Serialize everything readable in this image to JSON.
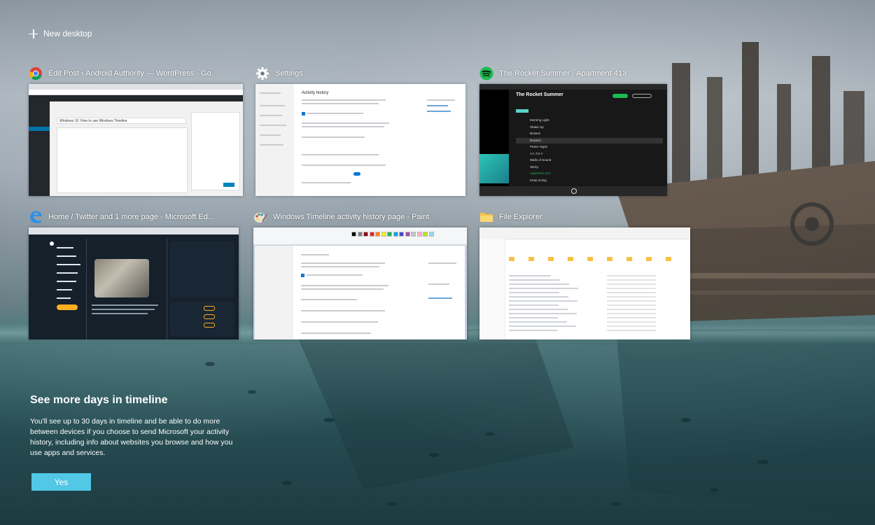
{
  "new_desktop_label": "New desktop",
  "windows": [
    {
      "app": "chrome",
      "title": "Edit Post ‹ Android Authority — WordPress - Go...",
      "icon": "chrome-icon"
    },
    {
      "app": "settings",
      "title": "Settings",
      "icon": "gear-icon"
    },
    {
      "app": "spotify",
      "title": "The Rocket Summer - Apartment 413",
      "icon": "spotify-icon"
    },
    {
      "app": "edge",
      "title": "Home / Twitter and 1 more page - Microsoft Ed...",
      "icon": "edge-icon"
    },
    {
      "app": "paint",
      "title": "Windows Timeline activity history page - Paint",
      "icon": "paint-icon"
    },
    {
      "app": "explorer",
      "title": "File Explorer",
      "icon": "folder-icon"
    }
  ],
  "thumbnails": {
    "wordpress_heading": "Windows 10: How to use Windows Timeline",
    "settings_heading": "Activity history",
    "spotify_artist": "The Rocket Summer",
    "spotify_tracks": [
      "Morning Light",
      "Shake Up",
      "Bruises",
      "Dreams",
      "Peace Signs",
      "Y.A.T.S.Y",
      "Walls of Sound",
      "Sticky",
      "Apartment 413",
      "Keep Going"
    ]
  },
  "promo": {
    "heading": "See more days in timeline",
    "body": "You'll see up to 30 days in timeline and be able to do more between devices if you choose to send Microsoft your activity history, including info about websites you browse and how you use apps and services.",
    "button_label": "Yes"
  },
  "colors": {
    "accent": "#52c7e6",
    "spotify_green": "#1db954",
    "wordpress_dark": "#23282d",
    "twitter_dark": "#15202b"
  }
}
